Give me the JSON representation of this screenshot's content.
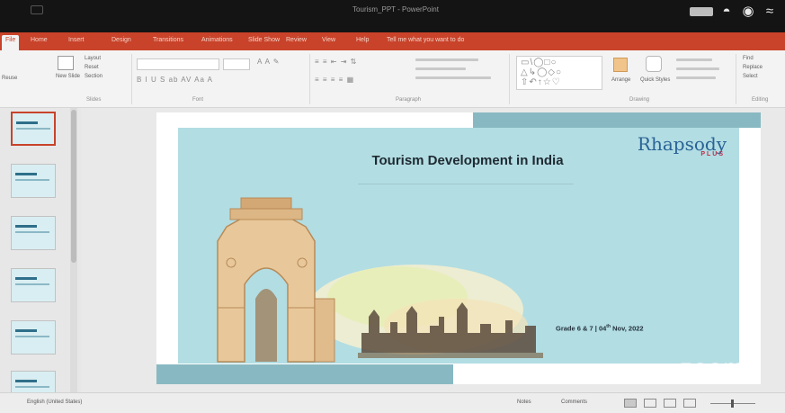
{
  "window": {
    "title": "Tourism_PPT - PowerPoint"
  },
  "ribbon_tabs": [
    "File",
    "Home",
    "Insert",
    "Design",
    "Transitions",
    "Animations",
    "Slide Show",
    "Review",
    "View",
    "Help",
    "Tell me what you want to do"
  ],
  "active_tab": "Home",
  "ribbon": {
    "slides_group": {
      "new_slide_label": "New Slide",
      "layout_label": "Layout",
      "reset_label": "Reset",
      "section_label": "Section",
      "group_label": "Slides"
    },
    "font_group": {
      "group_label": "Font"
    },
    "paragraph_group": {
      "group_label": "Paragraph"
    },
    "drawing_group": {
      "arrange_label": "Arrange",
      "quick_styles_label": "Quick Styles",
      "group_label": "Drawing"
    },
    "editing_group": {
      "find_label": "Find",
      "replace_label": "Replace",
      "select_label": "Select",
      "group_label": "Editing"
    }
  },
  "slide": {
    "title": "Tourism Development in India",
    "logo_main": "Rhapsody",
    "logo_sub": "PLUS",
    "footer_main": "Grade 6 & 7 | 04",
    "footer_sup": "th",
    "footer_tail": " Nov, 2022"
  },
  "thumbnail_count": 6,
  "statusbar": {
    "left_text": "English (United States)",
    "notes_label": "Notes",
    "comments_label": "Comments"
  },
  "watermark": "zoom",
  "colors": {
    "accent": "#c8432a",
    "panel": "#b2dde3",
    "deco": "#88b9c2",
    "logo_blue": "#2a6395",
    "logo_red": "#c52a46"
  }
}
